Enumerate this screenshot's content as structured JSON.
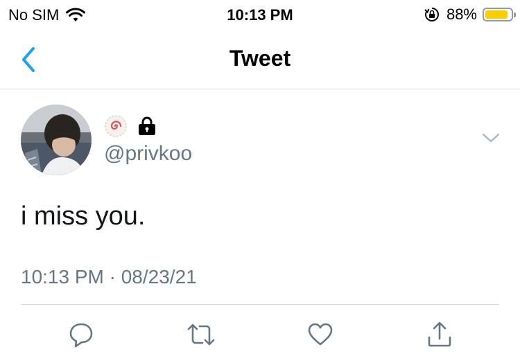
{
  "status_bar": {
    "carrier": "No SIM",
    "time": "10:13 PM",
    "battery_percent": "88%",
    "battery_level": 0.88,
    "battery_color": "#FFCC00",
    "icons": [
      "wifi-icon",
      "orientation-lock-icon",
      "battery-icon"
    ]
  },
  "navbar": {
    "title": "Tweet",
    "back_icon": "chevron-left-icon",
    "accent_color": "#1DA1F2"
  },
  "tweet": {
    "handle": "@privkoo",
    "text": "i miss you.",
    "timestamp": "10:13 PM · 08/23/21",
    "badges": [
      "fishcake-emoji",
      "lock-icon"
    ],
    "actions": [
      "reply-icon",
      "retweet-icon",
      "like-icon",
      "share-icon"
    ]
  }
}
